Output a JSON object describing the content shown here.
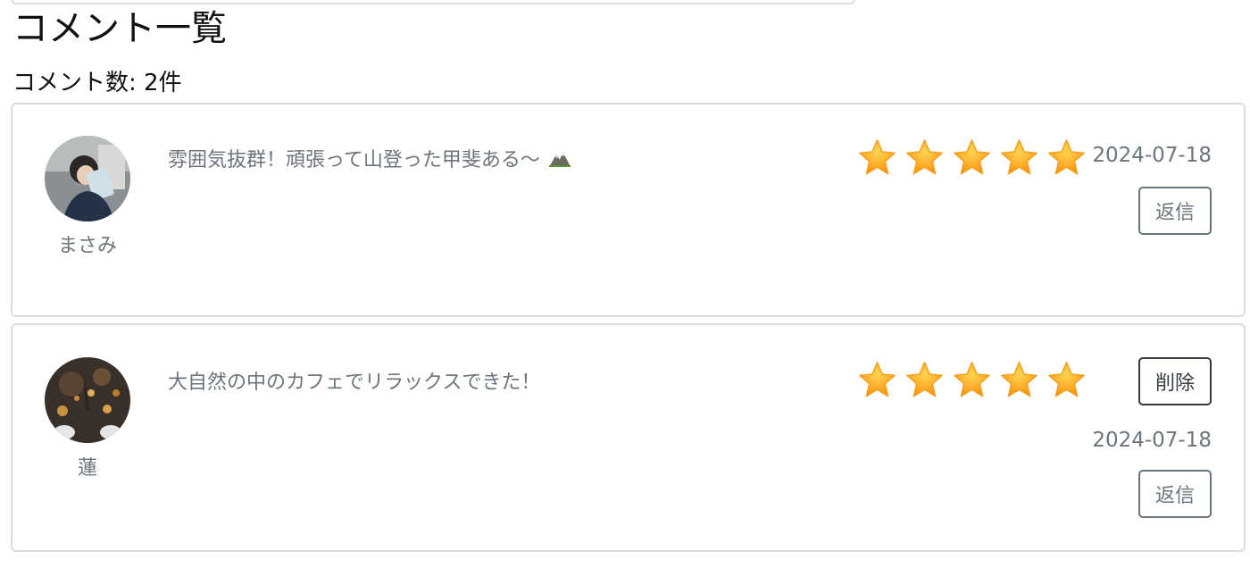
{
  "page": {
    "title": "コメント一覧",
    "comment_count": "コメント数: 2件"
  },
  "comments": [
    {
      "user_name": "まさみ",
      "text": "雰囲気抜群！頑張って山登った甲斐ある〜",
      "text_icon": "mountain-icon",
      "rating": 5,
      "rating_max": 5,
      "date": "2024-07-18",
      "reply_label": "返信",
      "avatar_icon": "avatar-photo-person-with-book"
    },
    {
      "user_name": "蓮",
      "text": "大自然の中のカフェでリラックスできた！",
      "rating": 5,
      "rating_max": 5,
      "date": "2024-07-18",
      "delete_label": "削除",
      "reply_label": "返信",
      "avatar_icon": "avatar-photo-autumn-leaves"
    }
  ],
  "colors": {
    "muted_text": "#6c757d",
    "dark_button": "#343a40",
    "card_border": "#dcdcdc",
    "star_fill": "#ffa726",
    "star_highlight": "#ffd54f"
  }
}
